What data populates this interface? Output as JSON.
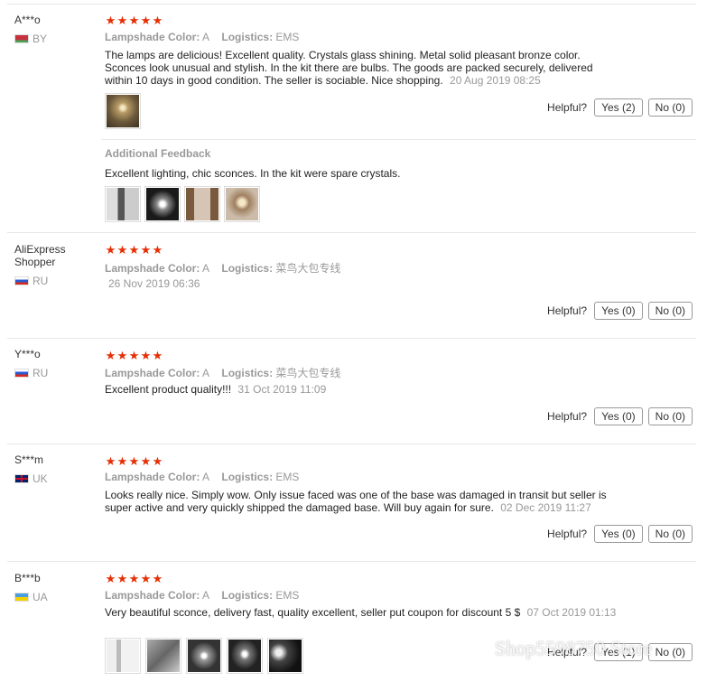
{
  "helpful_label": "Helpful?",
  "attr_keys": {
    "color": "Lampshade Color:",
    "logistics": "Logistics:"
  },
  "additional_feedback_title": "Additional Feedback",
  "reviews": [
    {
      "user": "A***o",
      "country": "BY",
      "rating": 5,
      "color": "A",
      "logistics": "EMS",
      "text": "The lamps are delicious! Excellent quality. Crystals glass shining. Metal solid pleasant bronze color. Sconces look unusual and stylish. In the kit there are bulbs. The goods are packed securely, delivered within 10 days in good condition. The seller is sociable. Nice shopping.",
      "date": "20 Aug 2019 08:25",
      "yes": "Yes (2)",
      "no": "No (0)",
      "photos": [
        "sconce-photo"
      ],
      "additional_text": "Excellent lighting, chic sconces. In the kit were spare crystals.",
      "additional_photos": [
        "sconce-photo",
        "sconce-photo",
        "sconce-photo",
        "sconce-photo"
      ]
    },
    {
      "user": "AliExpress Shopper",
      "country": "RU",
      "rating": 5,
      "color": "A",
      "logistics": "菜鸟大包专线",
      "date": "26 Nov 2019 06:36",
      "yes": "Yes (0)",
      "no": "No (0)"
    },
    {
      "user": "Y***o",
      "country": "RU",
      "rating": 5,
      "color": "A",
      "logistics": "菜鸟大包专线",
      "text": "Excellent product quality!!!",
      "date": "31 Oct 2019 11:09",
      "yes": "Yes (0)",
      "no": "No (0)"
    },
    {
      "user": "S***m",
      "country": "UK",
      "rating": 5,
      "color": "A",
      "logistics": "EMS",
      "text": "Looks really nice. Simply wow. Only issue faced was one of the base was damaged in transit but seller is super active and very quickly shipped the damaged base. Will buy again for sure.",
      "date": "02 Dec 2019 11:27",
      "yes": "Yes (0)",
      "no": "No (0)"
    },
    {
      "user": "B***b",
      "country": "UA",
      "rating": 5,
      "color": "A",
      "logistics": "EMS",
      "text": "Very beautiful sconce, delivery fast, quality excellent, seller put coupon for discount 5 $",
      "date": "07 Oct 2019 01:13",
      "yes": "Yes (1)",
      "no": "No (0)",
      "photos": [
        "sconce-photo",
        "sconce-photo",
        "sconce-photo",
        "sconce-photo",
        "sconce-photo"
      ]
    }
  ],
  "watermark": "Shop5598750 Store",
  "colors": {
    "star": "#e62e04",
    "muted": "#999999",
    "border": "#e6e6e6"
  }
}
